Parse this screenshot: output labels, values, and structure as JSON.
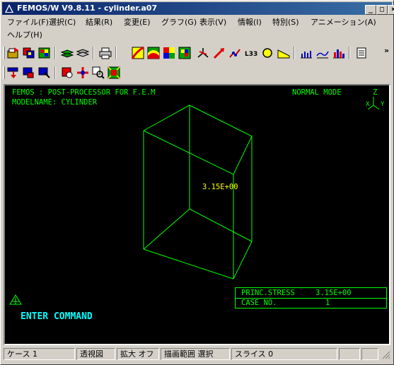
{
  "window": {
    "title": "FEMOS/W V9.8.11 - cylinder.a07",
    "min_label": "_",
    "max_label": "□",
    "close_label": "×"
  },
  "menu": [
    {
      "label": "ファイル(F)"
    },
    {
      "label": "選択(C)"
    },
    {
      "label": "結果(R)"
    },
    {
      "label": "変更(E)"
    },
    {
      "label": "グラフ(G)"
    },
    {
      "label": "表示(V)"
    },
    {
      "label": "情報(I)"
    },
    {
      "label": "特別(S)"
    },
    {
      "label": "アニメーション(A)"
    },
    {
      "label": "ヘルプ(H)"
    }
  ],
  "toolbar_overflow": "»",
  "toolbar1_icons": [
    "open-folder-icon",
    "copy-model-icon",
    "mesh-icon",
    "layers-icon",
    "stack-icon",
    "print-icon",
    "contour-icon",
    "fill-contour-icon",
    "color-grid-icon",
    "element-color-icon",
    "axis-icon",
    "vector-icon",
    "deform-icon",
    "label-icon",
    "circle-icon",
    "slope-icon",
    "graph-bar-icon",
    "graph-line-icon",
    "histogram-icon",
    "scroll-icon"
  ],
  "toolbar2_icons": [
    "select-down-icon",
    "select-node-icon",
    "select-element-icon",
    "rotate-icon",
    "move-icon",
    "zoom-icon",
    "fit-icon"
  ],
  "viewport": {
    "header_left": "FEMOS  : POST-PROCESSOR  FOR F.E.M",
    "header_mode": "NORMAL MODE",
    "model_name": "MODELNAME: CYLINDER",
    "axis_z": "Z",
    "axis_x": "X",
    "axis_y": "Y",
    "value_label": "3.15E+00",
    "info": {
      "stress_label": "PRINC.STRESS",
      "stress_value": "3.15E+00",
      "case_label": "CASE NO.",
      "case_value": "1"
    },
    "command_prompt": "ENTER COMMAND"
  },
  "status": {
    "case": "ケース 1",
    "view": "透視図",
    "zoom": "拡大 オフ",
    "draw_range": "描画範囲 選択",
    "slice": "スライス 0"
  },
  "colors": {
    "wireframe": "#00ff00",
    "label": "#ffff00",
    "command": "#00ffff"
  }
}
